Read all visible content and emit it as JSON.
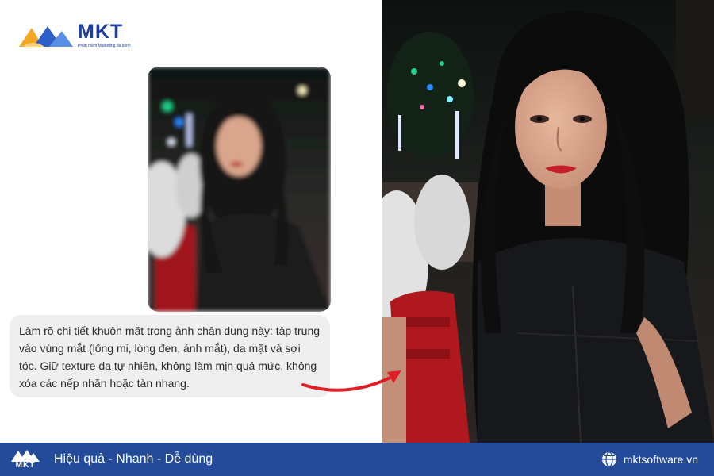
{
  "brand": {
    "name": "MKT",
    "tagline": "Phần mềm Marketing đa kênh",
    "colors": {
      "primary": "#234b9a",
      "logo_orange": "#f5a623",
      "logo_blue": "#1e3f9a",
      "arrow": "#e01e26"
    }
  },
  "prompt": {
    "text": "Làm rõ chi tiết khuôn mặt trong ảnh chân dung này: tập trung vào vùng mắt (lông mi, lòng đen, ánh mắt), da mặt và sợi tóc. Giữ texture da tự nhiên, không làm mịn quá mức, không xóa các nếp nhăn hoặc tàn nhang."
  },
  "images": {
    "before": {
      "state": "blurred",
      "icon": "portrait-photo-blurred"
    },
    "after": {
      "state": "sharpened",
      "icon": "portrait-photo-sharp"
    }
  },
  "arrow": {
    "icon": "curved-arrow-right-icon"
  },
  "footer": {
    "logo_text": "MKT",
    "slogan": "Hiệu quả - Nhanh - Dễ dùng",
    "website": "mktsoftware.vn",
    "website_icon": "globe-icon"
  }
}
